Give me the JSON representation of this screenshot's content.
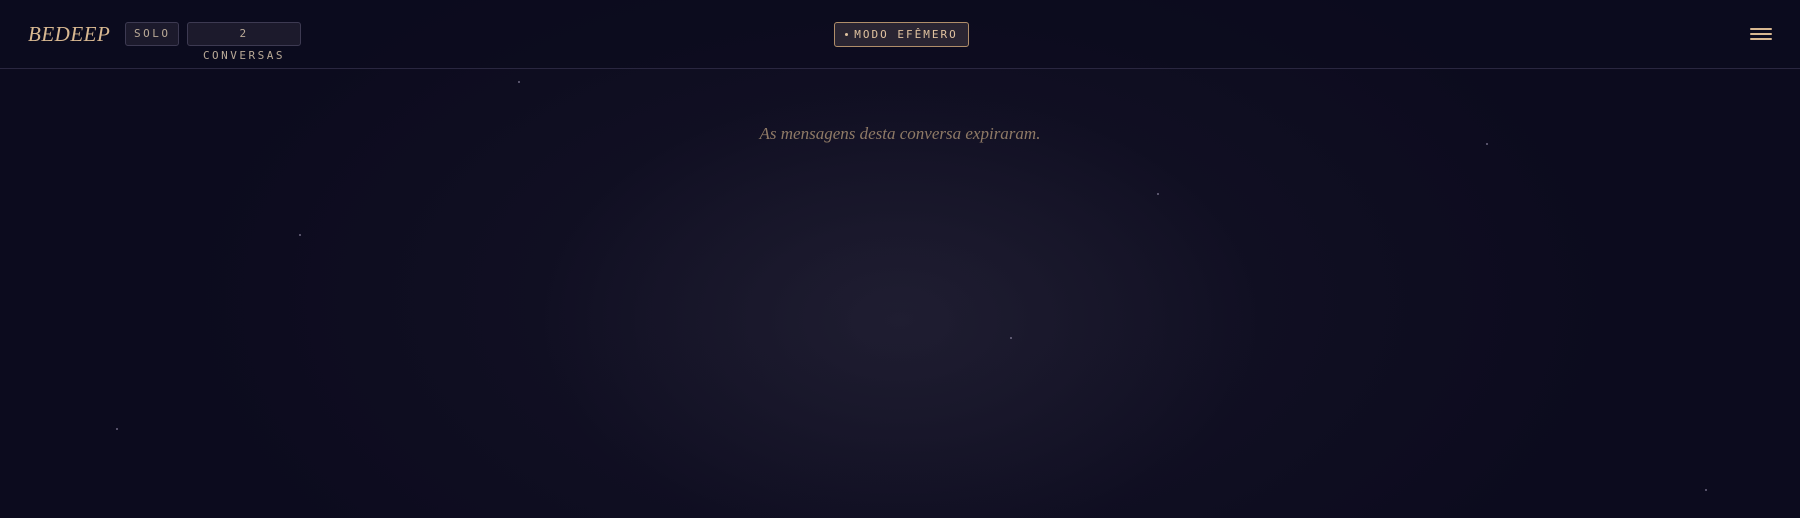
{
  "header": {
    "brand": "BEDEEP",
    "mode_chip": "SOLO",
    "conversations_chip": "2 CONVERSAS",
    "ephemeral_badge": "MODO EFÊMERO",
    "menu_icon": "hamburger-menu-icon"
  },
  "main": {
    "expired_message": "As mensagens desta conversa expiraram."
  },
  "colors": {
    "background": "#0c0b1e",
    "accent": "#d8b891",
    "muted_text": "#8f7a66"
  }
}
